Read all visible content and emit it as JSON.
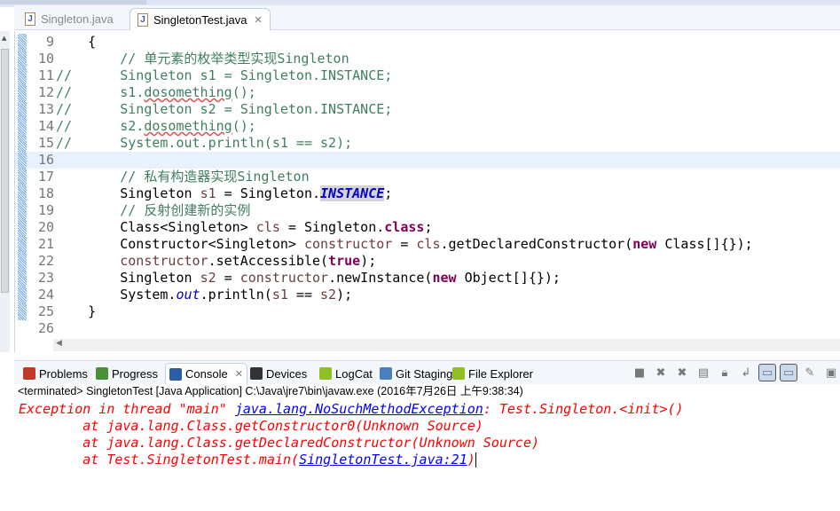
{
  "editor_tabs": [
    {
      "label": "Singleton.java",
      "icon": "java-file-icon",
      "active": false
    },
    {
      "label": "SingletonTest.java",
      "icon": "java-file-icon",
      "active": true
    }
  ],
  "code_lines": [
    {
      "n": "9",
      "t": [
        [
          "    {",
          ""
        ]
      ]
    },
    {
      "n": "10",
      "t": [
        [
          "        // 单元素的枚举类型实现Singleton",
          "c"
        ]
      ]
    },
    {
      "n": "11",
      "t": [
        [
          "//      Singleton s1 = Singleton.INSTANCE;",
          "c"
        ]
      ]
    },
    {
      "n": "12",
      "t": [
        [
          "//      s1.",
          "c"
        ],
        [
          "dosomething",
          "c sq"
        ],
        [
          "();",
          "c"
        ]
      ]
    },
    {
      "n": "13",
      "t": [
        [
          "//      Singleton s2 = Singleton.INSTANCE;",
          "c"
        ]
      ]
    },
    {
      "n": "14",
      "t": [
        [
          "//      s2.",
          "c"
        ],
        [
          "dosomething",
          "c sq"
        ],
        [
          "();",
          "c"
        ]
      ]
    },
    {
      "n": "15",
      "t": [
        [
          "//      System.out.println(s1 == s2);",
          "c"
        ]
      ]
    },
    {
      "n": "16",
      "t": [
        [
          "",
          ""
        ]
      ],
      "current": true
    },
    {
      "n": "17",
      "t": [
        [
          "        // 私有构造器实现Singleton",
          "c"
        ]
      ]
    },
    {
      "n": "18",
      "t": [
        [
          "        Singleton ",
          ""
        ],
        [
          "s1",
          "v"
        ],
        [
          " = Singleton.",
          ""
        ],
        [
          "INSTANCE",
          "sfh"
        ],
        [
          ";",
          ""
        ]
      ]
    },
    {
      "n": "19",
      "t": [
        [
          "        // 反射创建新的实例",
          "c"
        ]
      ]
    },
    {
      "n": "20",
      "t": [
        [
          "        Class<Singleton> ",
          ""
        ],
        [
          "cls",
          "v"
        ],
        [
          " = Singleton.",
          ""
        ],
        [
          "class",
          "k"
        ],
        [
          ";",
          ""
        ]
      ]
    },
    {
      "n": "21",
      "t": [
        [
          "        Constructor<Singleton> ",
          ""
        ],
        [
          "constructor",
          "v"
        ],
        [
          " = ",
          ""
        ],
        [
          "cls",
          "v"
        ],
        [
          ".getDeclaredConstructor(",
          ""
        ],
        [
          "new",
          "k"
        ],
        [
          " Class[]{});",
          ""
        ]
      ]
    },
    {
      "n": "22",
      "t": [
        [
          "        ",
          ""
        ],
        [
          "constructor",
          "v"
        ],
        [
          ".setAccessible(",
          ""
        ],
        [
          "true",
          "k"
        ],
        [
          ");",
          ""
        ]
      ]
    },
    {
      "n": "23",
      "t": [
        [
          "        Singleton ",
          ""
        ],
        [
          "s2",
          "v"
        ],
        [
          " = ",
          ""
        ],
        [
          "constructor",
          "v"
        ],
        [
          ".newInstance(",
          ""
        ],
        [
          "new",
          "k"
        ],
        [
          " Object[]{});",
          ""
        ]
      ]
    },
    {
      "n": "24",
      "t": [
        [
          "        System.",
          ""
        ],
        [
          "out",
          "sf"
        ],
        [
          ".println(",
          ""
        ],
        [
          "s1",
          "v"
        ],
        [
          " == ",
          ""
        ],
        [
          "s2",
          "v"
        ],
        [
          ");",
          ""
        ]
      ]
    },
    {
      "n": "25",
      "t": [
        [
          "    }",
          ""
        ]
      ]
    },
    {
      "n": "26",
      "t": [
        [
          "",
          ""
        ]
      ]
    }
  ],
  "panel_tabs": [
    {
      "label": "Problems",
      "icon": "problems-icon",
      "color": "#c0392b"
    },
    {
      "label": "Progress",
      "icon": "progress-icon",
      "color": "#4a8f3a"
    },
    {
      "label": "Console",
      "icon": "console-icon",
      "color": "#2a5da8",
      "active": true
    },
    {
      "label": "Devices",
      "icon": "devices-icon",
      "color": "#333333"
    },
    {
      "label": "LogCat",
      "icon": "logcat-icon",
      "color": "#8fbf20"
    },
    {
      "label": "Git Staging",
      "icon": "git-staging-icon",
      "color": "#4a7fc0"
    },
    {
      "label": "File Explorer",
      "icon": "android-icon",
      "color": "#8fbf20"
    }
  ],
  "console": {
    "status": "<terminated> SingletonTest [Java Application] C:\\Java\\jre7\\bin\\javaw.exe (2016年7月26日 上午9:38:34)",
    "l1_pre": "Exception in thread \"main\" ",
    "l1_link": "java.lang.NoSuchMethodException",
    "l1_post": ": Test.Singleton.<init>()",
    "l2": "        at java.lang.Class.getConstructor0(Unknown Source)",
    "l3": "        at java.lang.Class.getDeclaredConstructor(Unknown Source)",
    "l4_pre": "        at Test.SingletonTest.main(",
    "l4_link": "SingletonTest.java:21",
    "l4_post": ")"
  }
}
